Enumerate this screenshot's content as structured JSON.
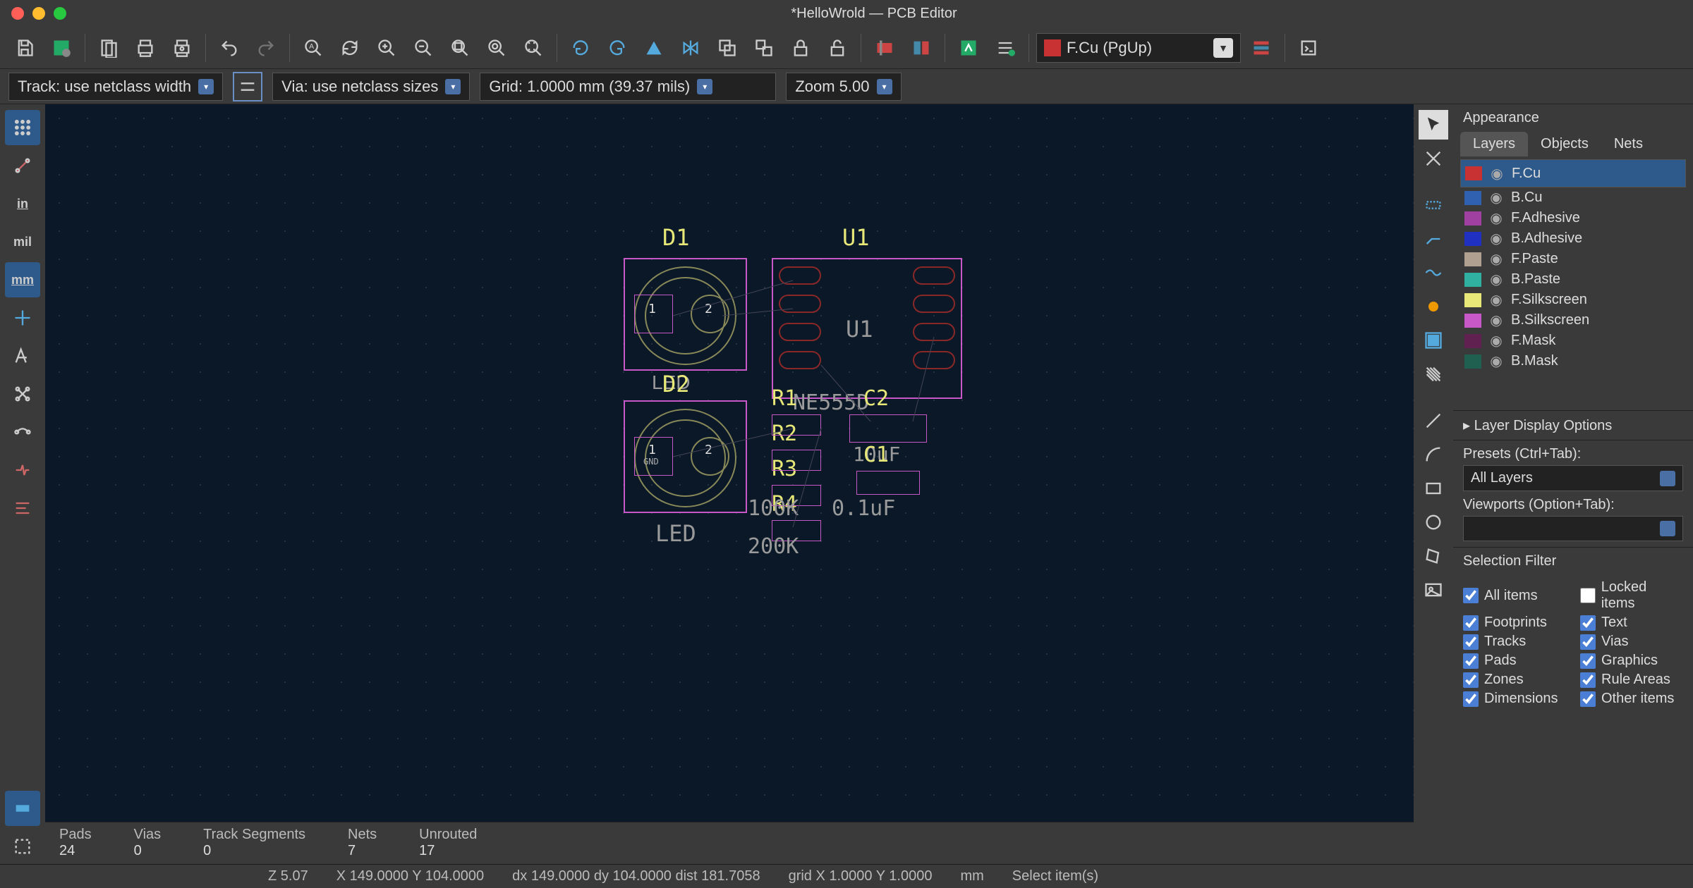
{
  "window": {
    "title": "*HelloWrold — PCB Editor"
  },
  "toolbar2": {
    "track": "Track: use netclass width",
    "via": "Via: use netclass sizes",
    "grid": "Grid: 1.0000 mm (39.37 mils)",
    "zoom": "Zoom 5.00"
  },
  "layer_selector": {
    "label": "F.Cu (PgUp)",
    "color": "#c83232"
  },
  "appearance": {
    "title": "Appearance",
    "tabs": [
      "Layers",
      "Objects",
      "Nets"
    ],
    "active_tab": 0,
    "layers": [
      {
        "name": "F.Cu",
        "color": "#c83232",
        "selected": true
      },
      {
        "name": "B.Cu",
        "color": "#3060b0"
      },
      {
        "name": "F.Adhesive",
        "color": "#a040a0"
      },
      {
        "name": "B.Adhesive",
        "color": "#2030c0"
      },
      {
        "name": "F.Paste",
        "color": "#b0a090"
      },
      {
        "name": "B.Paste",
        "color": "#30b0a0"
      },
      {
        "name": "F.Silkscreen",
        "color": "#e8e878"
      },
      {
        "name": "B.Silkscreen",
        "color": "#c858c8"
      },
      {
        "name": "F.Mask",
        "color": "#602050"
      },
      {
        "name": "B.Mask",
        "color": "#206050"
      }
    ],
    "layer_display": "Layer Display Options",
    "presets_label": "Presets (Ctrl+Tab):",
    "presets_value": "All Layers",
    "viewports_label": "Viewports (Option+Tab):",
    "viewports_value": ""
  },
  "selection_filter": {
    "title": "Selection Filter",
    "items": [
      {
        "label": "All items",
        "checked": true
      },
      {
        "label": "Locked items",
        "checked": false
      },
      {
        "label": "Footprints",
        "checked": true
      },
      {
        "label": "Text",
        "checked": true
      },
      {
        "label": "Tracks",
        "checked": true
      },
      {
        "label": "Vias",
        "checked": true
      },
      {
        "label": "Pads",
        "checked": true
      },
      {
        "label": "Graphics",
        "checked": true
      },
      {
        "label": "Zones",
        "checked": true
      },
      {
        "label": "Rule Areas",
        "checked": true
      },
      {
        "label": "Dimensions",
        "checked": true
      },
      {
        "label": "Other items",
        "checked": true
      }
    ]
  },
  "stats": {
    "pads": {
      "label": "Pads",
      "value": "24"
    },
    "vias": {
      "label": "Vias",
      "value": "0"
    },
    "tracks": {
      "label": "Track Segments",
      "value": "0"
    },
    "nets": {
      "label": "Nets",
      "value": "7"
    },
    "unrouted": {
      "label": "Unrouted",
      "value": "17"
    }
  },
  "statusbar": {
    "z": "Z 5.07",
    "xy": "X 149.0000  Y 104.0000",
    "dxy": "dx 149.0000  dy 104.0000  dist 181.7058",
    "grid": "grid X 1.0000  Y 1.0000",
    "unit": "mm",
    "hint": "Select item(s)"
  },
  "canvas": {
    "labels": {
      "D1": "D1",
      "D2": "D2",
      "U1": "U1",
      "U1b": "U1",
      "R1": "R1",
      "R2": "R2",
      "R3": "R3",
      "R4": "R4",
      "C1": "C1",
      "C2": "C2",
      "LED1": "LED",
      "LED2": "LED",
      "NE555D": "NE555D",
      "v10uF": "10uF",
      "v01uF": "0.1uF",
      "v100K": "100K",
      "v200K": "200K",
      "pad1": "1",
      "pad2": "2",
      "GND": "GND"
    }
  }
}
